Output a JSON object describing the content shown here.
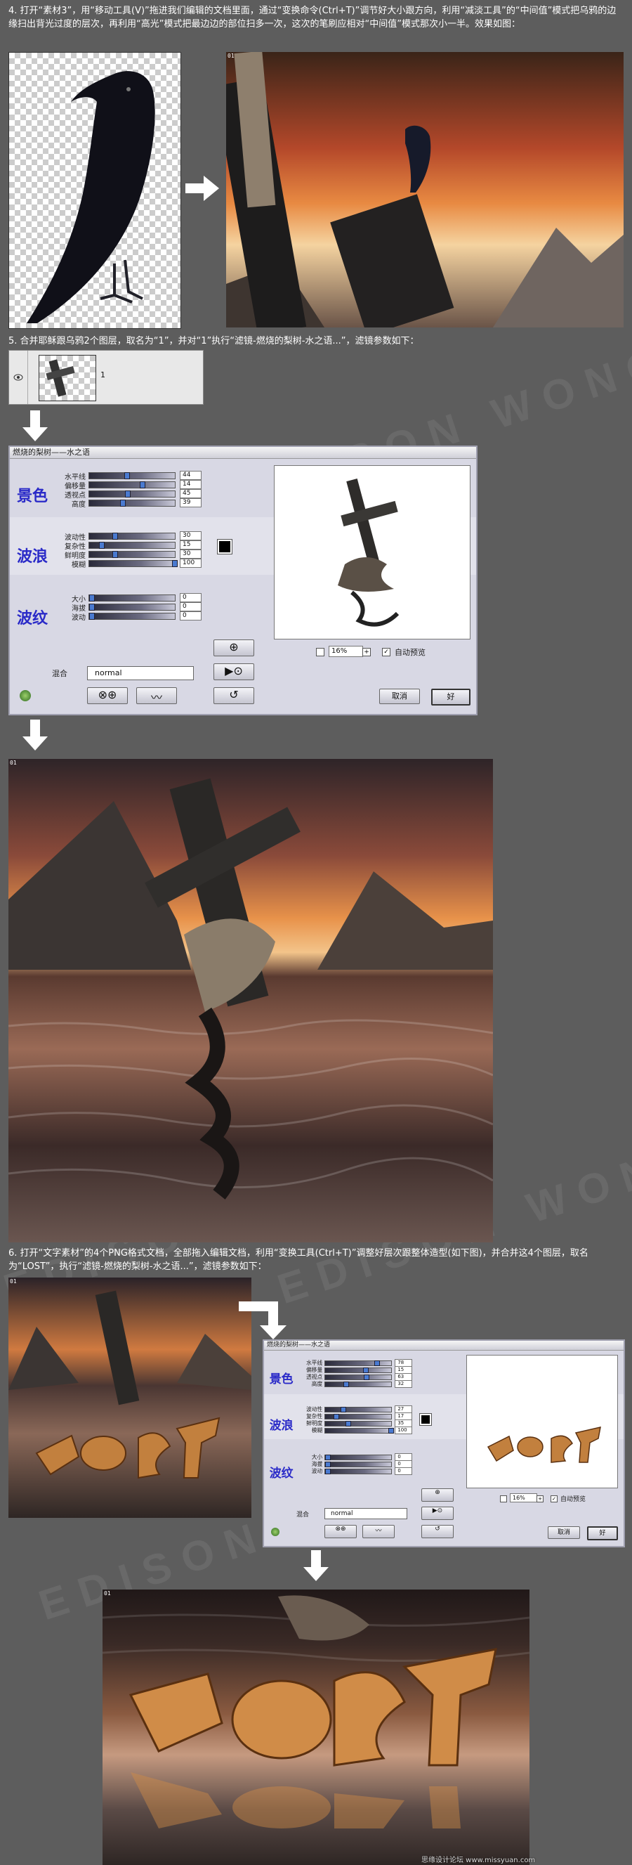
{
  "step4": {
    "text": "4. 打开“素材3”，用“移动工具(V)”拖进我们编辑的文档里面，通过“变换命令(Ctrl+T)”调节好大小跟方向，利用“减淡工具”的“中间值”模式把乌鸦的边缘扫出背光过度的层次，再利用“高光”模式把最边边的部位扫多一次，这次的笔刷应相对“中间值”模式那次小一半。效果如图："
  },
  "step5": {
    "text": "5. 合并耶稣跟乌鸦2个图层，取名为“1”，并对“1”执行“滤镜-燃烧的梨树-水之语...”，滤镜参数如下：",
    "layer_name": "1"
  },
  "step6": {
    "text": "6. 打开“文字素材”的4个PNG格式文档，全部拖入编辑文档，利用“变换工具(Ctrl+T)”调整好层次跟整体造型(如下图)，并合并这4个图层，取名为“LOST”，执行“滤镜-燃烧的梨树-水之语...”，滤镜参数如下："
  },
  "watermark": "EDISON WONG 7",
  "footer": "思缘设计论坛 www.missyuan.com",
  "dialog1": {
    "title": "燃烧的梨树——水之语",
    "sections": [
      {
        "title": "景色",
        "params": [
          {
            "label": "水平线",
            "value": "44",
            "frac": 0.44
          },
          {
            "label": "偏移量",
            "value": "14",
            "frac": 0.62
          },
          {
            "label": "透视点",
            "value": "45",
            "frac": 0.45
          },
          {
            "label": "高度",
            "value": "39",
            "frac": 0.39
          }
        ]
      },
      {
        "title": "波浪",
        "params": [
          {
            "label": "波动性",
            "value": "30",
            "frac": 0.3
          },
          {
            "label": "复杂性",
            "value": "15",
            "frac": 0.15
          },
          {
            "label": "鲜明度",
            "value": "30",
            "frac": 0.3
          },
          {
            "label": "模糊",
            "value": "100",
            "frac": 1.0
          }
        ]
      },
      {
        "title": "波纹",
        "params": [
          {
            "label": "大小",
            "value": "0",
            "frac": 0
          },
          {
            "label": "海拔",
            "value": "0",
            "frac": 0
          },
          {
            "label": "波动",
            "value": "0",
            "frac": 0
          }
        ]
      }
    ],
    "blend_label": "混合",
    "blend_value": "normal",
    "zoom": "16%",
    "preview_label": "自动预览",
    "cancel": "取消",
    "ok": "好"
  },
  "dialog2": {
    "title": "燃烧的梨树——水之语",
    "sections": [
      {
        "title": "景色",
        "params": [
          {
            "label": "水平线",
            "value": "78",
            "frac": 0.78
          },
          {
            "label": "偏移量",
            "value": "15",
            "frac": 0.62
          },
          {
            "label": "透视点",
            "value": "63",
            "frac": 0.63
          },
          {
            "label": "高度",
            "value": "32",
            "frac": 0.32
          }
        ]
      },
      {
        "title": "波浪",
        "params": [
          {
            "label": "波动性",
            "value": "27",
            "frac": 0.27
          },
          {
            "label": "复杂性",
            "value": "17",
            "frac": 0.17
          },
          {
            "label": "鲜明度",
            "value": "35",
            "frac": 0.35
          },
          {
            "label": "模糊",
            "value": "100",
            "frac": 1.0
          }
        ]
      },
      {
        "title": "波纹",
        "params": [
          {
            "label": "大小",
            "value": "0",
            "frac": 0
          },
          {
            "label": "海拔",
            "value": "0",
            "frac": 0
          },
          {
            "label": "波动",
            "value": "0",
            "frac": 0
          }
        ]
      }
    ],
    "blend_label": "混合",
    "blend_value": "normal",
    "zoom": "16%",
    "preview_label": "自动预览",
    "cancel": "取消",
    "ok": "好"
  },
  "colors": {
    "page_bg": "#5d5d5d",
    "dialog_bg": "#d8d8e4",
    "section_title": "#2a2ac8"
  }
}
